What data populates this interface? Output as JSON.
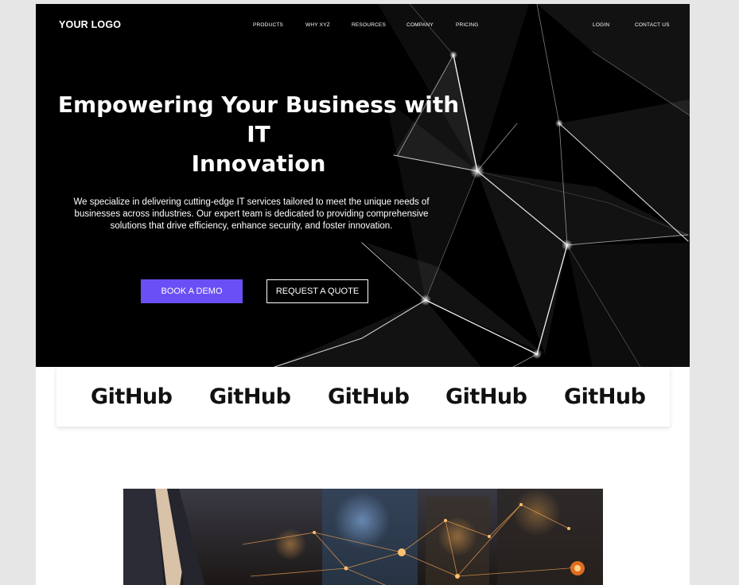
{
  "header": {
    "logo": "YOUR LOGO",
    "nav": [
      "PRODUCTS",
      "WHY XYZ",
      "RESOURCES",
      "COMPANY",
      "PRICING"
    ],
    "login": "LOGIN",
    "contact": "CONTACT US"
  },
  "hero": {
    "title_line1": "Empowering Your Business with IT",
    "title_line2": "Innovation",
    "description_line1": "We specialize in delivering cutting-edge IT services tailored to meet the unique needs of",
    "description_line2": "businesses across industries. Our expert team is dedicated to providing comprehensive",
    "description_line3": "solutions that drive efficiency, enhance security, and foster innovation.",
    "primary_cta": "BOOK A DEMO",
    "secondary_cta": "REQUEST A QUOTE"
  },
  "partners": [
    "GitHub",
    "GitHub",
    "GitHub",
    "GitHub",
    "GitHub"
  ],
  "colors": {
    "accent": "#6b4ff6",
    "hero_background": "#000000",
    "page_background": "#ffffff",
    "canvas_background": "#e6e6e6"
  }
}
